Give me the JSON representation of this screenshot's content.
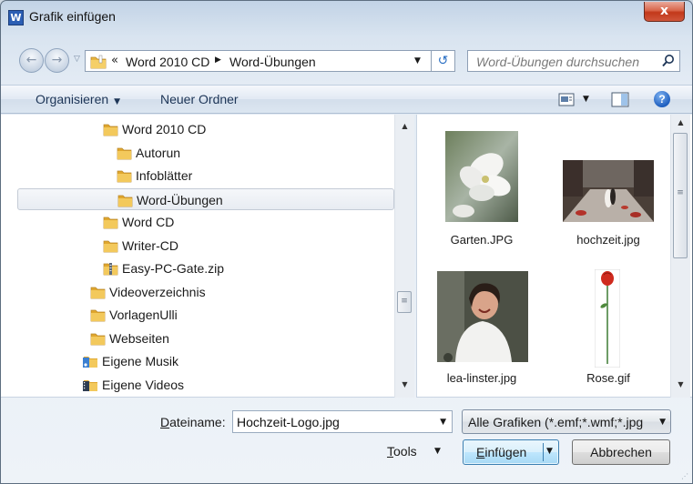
{
  "window": {
    "title": "Grafik einfügen",
    "app_icon_letter": "W",
    "close_glyph": "x"
  },
  "nav": {
    "back_glyph": "←",
    "forward_glyph": "→",
    "breadcrumb_overflow": "«",
    "breadcrumb": [
      "Word 2010 CD",
      "Word-Übungen"
    ],
    "search_placeholder": "Word-Übungen durchsuchen"
  },
  "toolbar": {
    "organize_label": "Organisieren",
    "new_folder_label": "Neuer Ordner",
    "help_glyph": "?"
  },
  "tree": {
    "items": [
      {
        "label": "Word 2010 CD",
        "icon": "folder-icon",
        "selected": false
      },
      {
        "label": "Autorun",
        "icon": "folder-icon",
        "selected": false
      },
      {
        "label": "Infoblätter",
        "icon": "folder-icon",
        "selected": false
      },
      {
        "label": "Word-Übungen",
        "icon": "folder-icon",
        "selected": true
      },
      {
        "label": "Word CD",
        "icon": "folder-icon",
        "selected": false
      },
      {
        "label": "Writer-CD",
        "icon": "folder-icon",
        "selected": false
      },
      {
        "label": "Easy-PC-Gate.zip",
        "icon": "zip-folder-icon",
        "selected": false
      },
      {
        "label": "Videoverzeichnis",
        "icon": "folder-icon",
        "selected": false
      },
      {
        "label": "VorlagenUlli",
        "icon": "folder-icon",
        "selected": false
      },
      {
        "label": "Webseiten",
        "icon": "folder-icon",
        "selected": false
      },
      {
        "label": "Eigene Musik",
        "icon": "music-library-icon",
        "selected": false
      },
      {
        "label": "Eigene Videos",
        "icon": "video-library-icon",
        "selected": false
      }
    ]
  },
  "files": [
    {
      "name": "Garten.JPG",
      "thumbnail": "white-blossom-photo"
    },
    {
      "name": "hochzeit.jpg",
      "thumbnail": "wedding-street-photo"
    },
    {
      "name": "lea-linster.jpg",
      "thumbnail": "smiling-woman-photo"
    },
    {
      "name": "Rose.gif",
      "thumbnail": "red-rose-image"
    }
  ],
  "bottom": {
    "filename_label_underlined": "D",
    "filename_label_rest": "ateiname:",
    "filename_value": "Hochzeit-Logo.jpg",
    "filter_label": "Alle Grafiken (*.emf;*.wmf;*.jpg",
    "tools_underlined": "T",
    "tools_rest": "ools",
    "insert_underlined": "E",
    "insert_rest": "infügen",
    "cancel_label": "Abbrechen"
  },
  "colors": {
    "folder": "#e8b63f",
    "selection": "#e8ecf2",
    "close_button": "#c2381a",
    "accent_button": "#bee6fd"
  }
}
